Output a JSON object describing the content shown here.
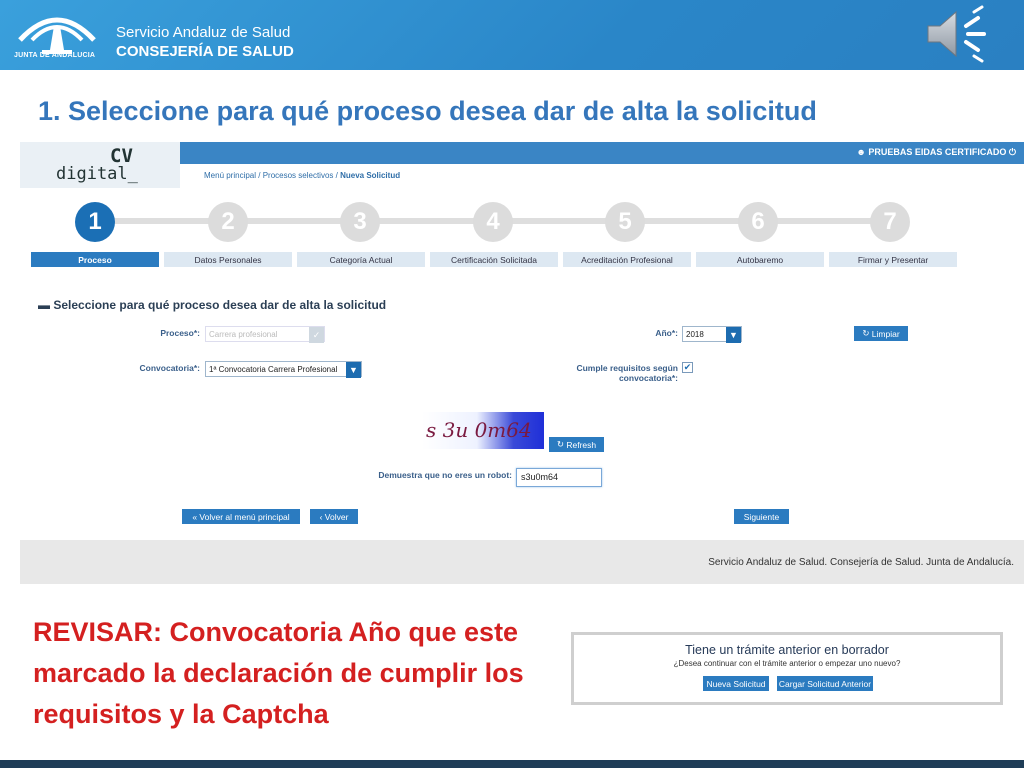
{
  "header": {
    "logo_caption": "JUNTA DE ANDALUCIA",
    "org_line1": "Servicio Andaluz de Salud",
    "org_line2": "CONSEJERÍA DE SALUD",
    "sound_icon": "speaker-icon",
    "brand_color": "#2f8fcf"
  },
  "slide": {
    "title": "1.   Seleccione para qué proceso desea dar de alta la solicitud",
    "note": "REVISAR: Convocatoria Año que este marcado la declaración de cumplir los requisitos y la Captcha"
  },
  "app": {
    "logo_line1": "CV",
    "logo_line2": "digital_",
    "user": "PRUEBAS EIDAS CERTIFICADO",
    "breadcrumb": {
      "home": "Menú principal",
      "sep": " / ",
      "procesos": "Procesos selectivos",
      "current": "Nueva Solicitud"
    },
    "steps": [
      "1",
      "2",
      "3",
      "4",
      "5",
      "6",
      "7"
    ],
    "tabs": [
      "Proceso",
      "Datos Personales",
      "Categoría Actual",
      "Certificación Solicitada",
      "Acreditación Profesional",
      "Autobaremo",
      "Firmar y Presentar"
    ],
    "section_title": "Seleccione para qué proceso desea dar de alta la solicitud",
    "form": {
      "proceso_label": "Proceso*:",
      "proceso_value": "Carrera profesional",
      "anio_label": "Año*:",
      "anio_value": "2018",
      "limpiar_label": "Limpiar",
      "convocatoria_label": "Convocatoria*:",
      "convocatoria_value": "1ª Convocatoria Carrera Profesional",
      "requisitos_label_1": "Cumple requisitos según",
      "requisitos_label_2": "convocatoria*:",
      "requisitos_checked": true,
      "captcha_text": "s 3u 0m64",
      "refresh_label": "Refresh",
      "robot_label": "Demuestra que no eres un robot:",
      "robot_value": "s3u0m64",
      "volver_menu_label": "Volver al menú principal",
      "volver_label": "Volver",
      "siguiente_label": "Siguiente"
    },
    "footer": "Servicio Andaluz de Salud. Consejería de Salud. Junta de Andalucía."
  },
  "dialog": {
    "title": "Tiene un trámite anterior en borrador",
    "subtitle": "¿Desea continuar con el trámite anterior o empezar uno nuevo?",
    "new_label": "Nueva Solicitud",
    "load_label": "Cargar Solicitud Anterior"
  }
}
